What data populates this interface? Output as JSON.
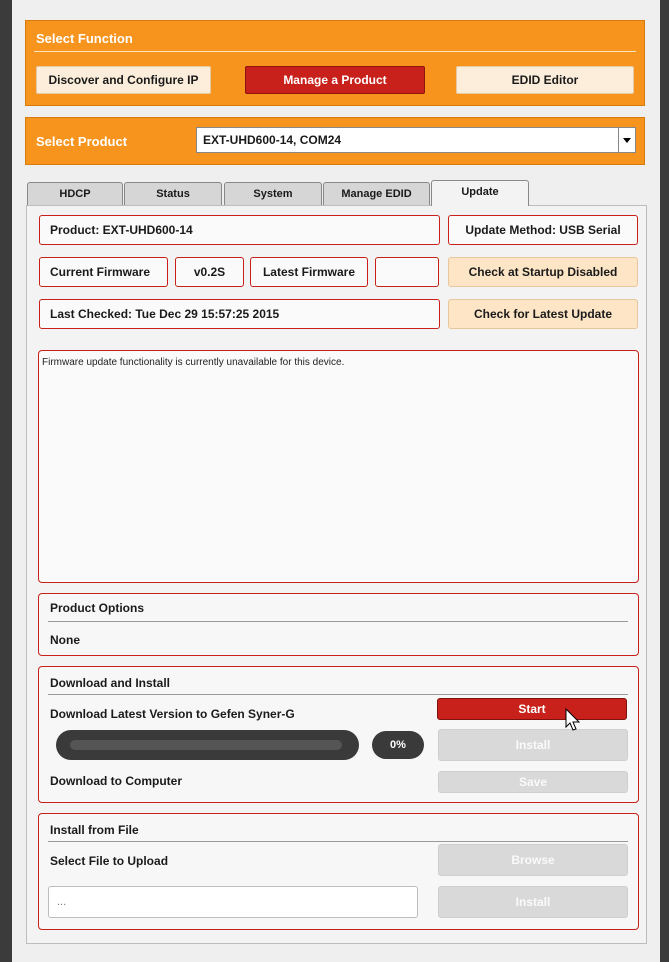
{
  "select_function": {
    "title": "Select Function",
    "buttons": [
      "Discover and Configure IP",
      "Manage a Product",
      "EDID Editor"
    ],
    "active_index": 1
  },
  "select_product": {
    "title": "Select Product",
    "value": "EXT-UHD600-14, COM24"
  },
  "tabs": [
    "HDCP",
    "Status",
    "System",
    "Manage EDID",
    "Update"
  ],
  "active_tab": "Update",
  "update": {
    "product_label": "Product: EXT-UHD600-14",
    "method_label": "Update Method: USB Serial",
    "current_firmware_label": "Current Firmware",
    "current_firmware_value": "v0.2S",
    "latest_firmware_label": "Latest Firmware",
    "latest_firmware_value": "",
    "check_startup_button": "Check at Startup Disabled",
    "last_checked": "Last Checked: Tue Dec 29 15:57:25 2015",
    "check_latest_button": "Check for Latest Update",
    "log_text": "Firmware update functionality is currently unavailable for this device."
  },
  "product_options": {
    "title": "Product Options",
    "value": "None"
  },
  "download_install": {
    "title": "Download and Install",
    "download_latest_label": "Download Latest Version to Gefen Syner-G",
    "start_button": "Start",
    "install_button": "Install",
    "progress_percent": 0,
    "progress_text": "0%",
    "download_computer_label": "Download to Computer",
    "save_button": "Save"
  },
  "install_from_file": {
    "title": "Install from File",
    "select_label": "Select File to Upload",
    "browse_button": "Browse",
    "file_value": "...",
    "install_button": "Install"
  },
  "colors": {
    "orange": "#f7941d",
    "red": "#c8201a",
    "peach": "#fde5c6"
  }
}
